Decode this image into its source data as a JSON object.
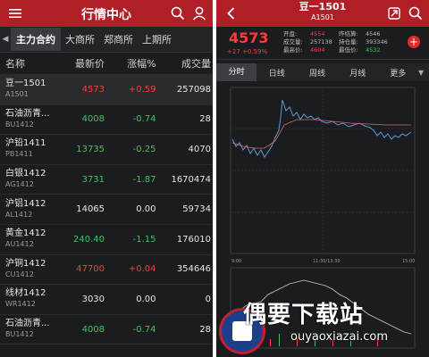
{
  "left": {
    "title": "行情中心",
    "tabs": [
      "主力合约",
      "大商所",
      "郑商所",
      "上期所"
    ],
    "columns": [
      "名称",
      "最新价",
      "涨幅%",
      "成交量"
    ],
    "rows": [
      {
        "name": "豆一1501",
        "code": "A1501",
        "price": "4573",
        "pchg": "+0.59",
        "vol": "257098",
        "pc": "up",
        "cc": "up"
      },
      {
        "name": "石油沥青...",
        "code": "BU1412",
        "price": "4008",
        "pchg": "-0.74",
        "vol": "28",
        "pc": "dn",
        "cc": "dn"
      },
      {
        "name": "沪铅1411",
        "code": "PB1411",
        "price": "13735",
        "pchg": "-0.25",
        "vol": "4070",
        "pc": "dn",
        "cc": "dn"
      },
      {
        "name": "白银1412",
        "code": "AG1412",
        "price": "3731",
        "pchg": "-1.87",
        "vol": "1670474",
        "pc": "dn",
        "cc": "dn"
      },
      {
        "name": "沪铝1412",
        "code": "AL1412",
        "price": "14065",
        "pchg": "0.00",
        "vol": "59734",
        "pc": "fl",
        "cc": "fl"
      },
      {
        "name": "黄金1412",
        "code": "AU1412",
        "price": "240.40",
        "pchg": "-1.15",
        "vol": "176010",
        "pc": "dn",
        "cc": "dn"
      },
      {
        "name": "沪铜1412",
        "code": "CU1412",
        "price": "47700",
        "pchg": "+0.04",
        "vol": "354646",
        "pc": "up",
        "cc": "up"
      },
      {
        "name": "线材1412",
        "code": "WR1412",
        "price": "3030",
        "pchg": "0.00",
        "vol": "0",
        "pc": "fl",
        "cc": "fl"
      },
      {
        "name": "石油沥青...",
        "code": "BU1412",
        "price": "4008",
        "pchg": "-0.74",
        "vol": "28",
        "pc": "dn",
        "cc": "dn"
      }
    ]
  },
  "right": {
    "title": "豆一1501",
    "code": "A1501",
    "price": "4573",
    "change": "+27 +0.59%",
    "stats": [
      [
        "开盘:",
        "4554",
        "昨结算:",
        "4546"
      ],
      [
        "成交量:",
        "257138",
        "持仓量:",
        "393346"
      ],
      [
        "最高价:",
        "4604",
        "最低价:",
        "4532"
      ]
    ],
    "period_tabs": [
      "分时",
      "日线",
      "周线",
      "月线",
      "更多"
    ],
    "time_labels": [
      "9:00",
      "11:30/13:30",
      "15:00"
    ]
  },
  "watermark": {
    "text": "偶要下载站",
    "url": "ouyaoxiazai.com"
  },
  "colors": {
    "header": "#b01e28",
    "background": "#1b1c1f",
    "up": "#ff3b3b",
    "down": "#3dc55a"
  }
}
